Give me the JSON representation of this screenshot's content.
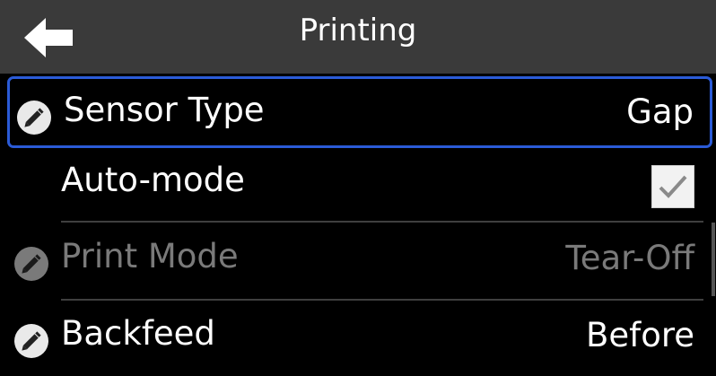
{
  "header": {
    "title": "Printing",
    "back_icon": "back-arrow-icon"
  },
  "settings": [
    {
      "label": "Sensor Type",
      "value": "Gap",
      "editable": true,
      "selected": true,
      "disabled": false
    },
    {
      "label": "Auto-mode",
      "type": "checkbox",
      "checked": true
    },
    {
      "label": "Print Mode",
      "value": "Tear-Off",
      "editable": true,
      "disabled": true
    },
    {
      "label": "Backfeed",
      "value": "Before",
      "editable": true,
      "disabled": false
    }
  ],
  "colors": {
    "header_bg": "#3a3a3a",
    "selection_border": "#2b5bd7",
    "disabled_text": "#7a7a7a"
  }
}
